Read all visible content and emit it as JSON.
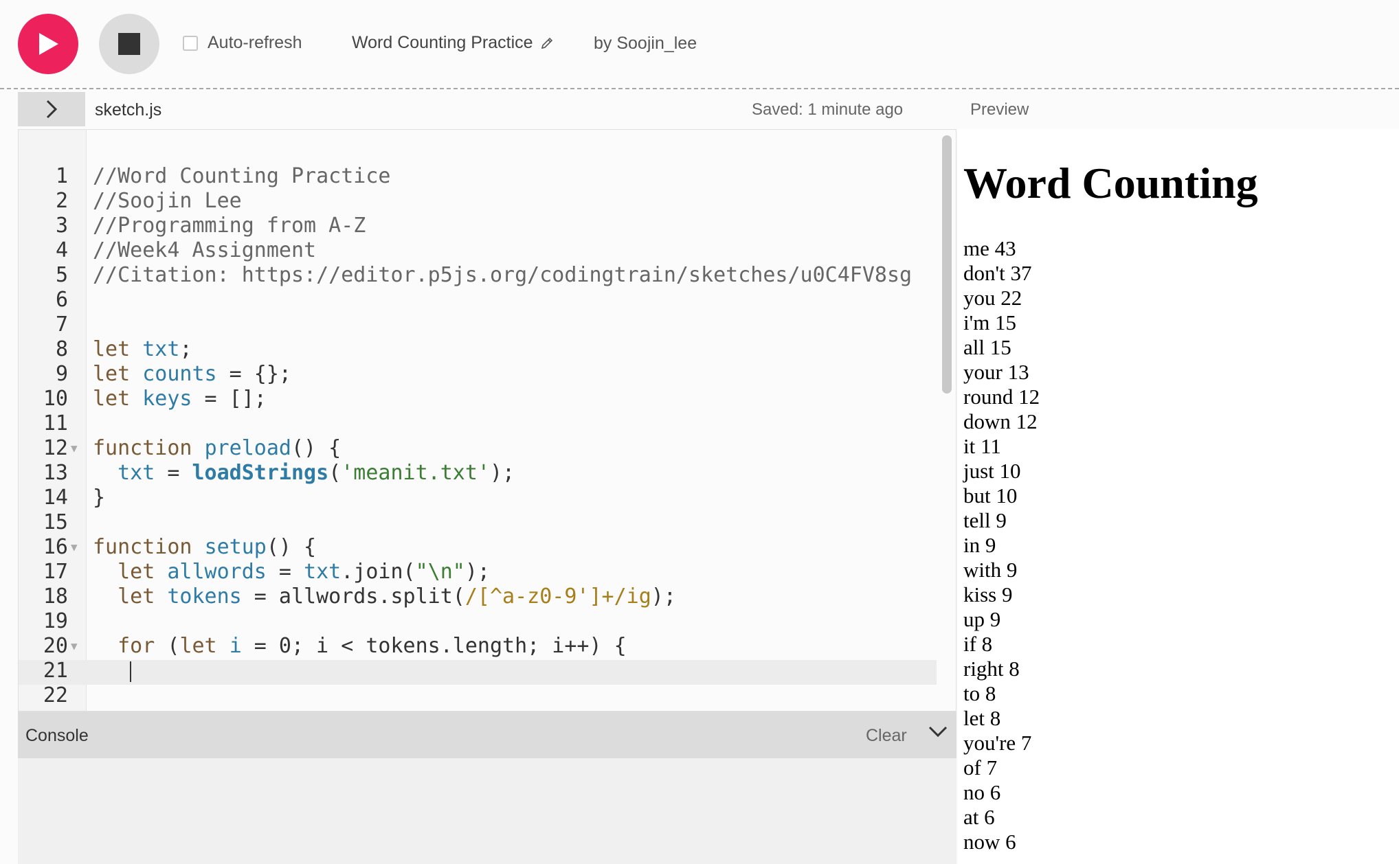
{
  "toolbar": {
    "autorefresh_label": "Auto-refresh",
    "project_title": "Word Counting Practice",
    "author": "by Soojin_lee"
  },
  "editor": {
    "filename": "sketch.js",
    "saved_status": "Saved: 1 minute ago",
    "line_numbers": [
      "1",
      "2",
      "3",
      "4",
      "5",
      "6",
      "7",
      "8",
      "9",
      "10",
      "11",
      "12",
      "13",
      "14",
      "15",
      "16",
      "17",
      "18",
      "19",
      "20",
      "21",
      "22"
    ]
  },
  "preview": {
    "label": "Preview",
    "heading": "Word Counting",
    "words": [
      "me 43",
      "don't 37",
      "you 22",
      "i'm 15",
      "all 15",
      "your 13",
      "round 12",
      "down 12",
      "it 11",
      "just 10",
      "but 10",
      "tell 9",
      "in 9",
      "with 9",
      "kiss 9",
      "up 9",
      "if 8",
      "right 8",
      "to 8",
      "let 8",
      "you're 7",
      "of 7",
      "no 6",
      "at 6",
      "now 6"
    ]
  },
  "console": {
    "label": "Console",
    "clear_label": "Clear"
  },
  "colors": {
    "play_button": "#ed225d",
    "stop_button": "#dcdcdc",
    "console_bar": "#dcdcdc"
  }
}
